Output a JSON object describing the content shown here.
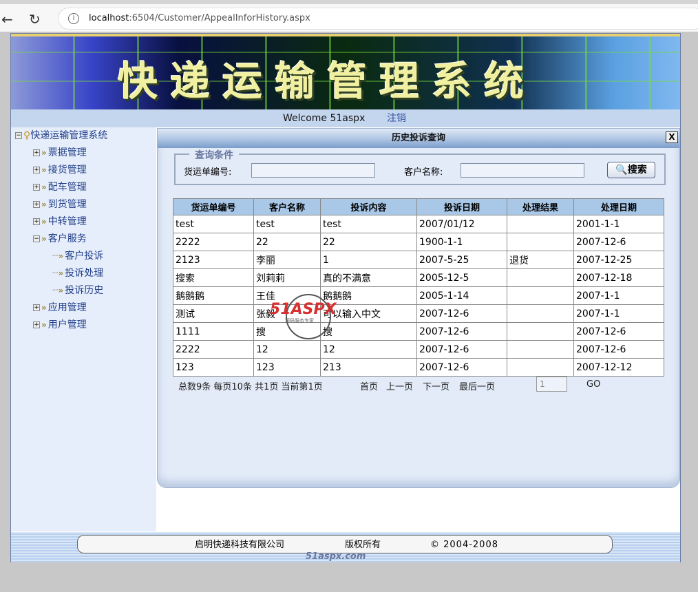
{
  "browser": {
    "url_host": "localhost",
    "url_path": ":6504/Customer/AppealInforHistory.aspx"
  },
  "banner": {
    "title": "快递运输管理系统"
  },
  "welcome": {
    "text": "Welcome 51aspx",
    "logout": "注销"
  },
  "sidebar": {
    "root": "快递运输管理系统",
    "items": [
      {
        "label": "票据管理",
        "expanded": false
      },
      {
        "label": "接货管理",
        "expanded": false
      },
      {
        "label": "配车管理",
        "expanded": false
      },
      {
        "label": "到货管理",
        "expanded": false
      },
      {
        "label": "中转管理",
        "expanded": false
      },
      {
        "label": "客户服务",
        "expanded": true
      },
      {
        "label": "应用管理",
        "expanded": false
      },
      {
        "label": "用户管理",
        "expanded": false
      }
    ],
    "children": [
      "客户投诉",
      "投诉处理",
      "投诉历史"
    ]
  },
  "panel": {
    "title": "历史投诉查询",
    "close": "X"
  },
  "search": {
    "legend": "查询条件",
    "waybill_label": "货运单编号:",
    "waybill_value": "",
    "customer_label": "客户名称:",
    "customer_value": "",
    "button": "搜索"
  },
  "table": {
    "headers": [
      "货运单编号",
      "客户名称",
      "投诉内容",
      "投诉日期",
      "处理结果",
      "处理日期"
    ],
    "rows": [
      [
        "test",
        "test",
        "test",
        "2007/01/12",
        "",
        "2001-1-1"
      ],
      [
        "2222",
        "22",
        "22",
        "1900-1-1",
        "",
        "2007-12-6"
      ],
      [
        "2123",
        "李丽",
        "1",
        "2007-5-25",
        "退货",
        "2007-12-25"
      ],
      [
        "搜索",
        "刘莉莉",
        "真的不满意",
        "2005-12-5",
        "",
        "2007-12-18"
      ],
      [
        "鹅鹅鹅",
        "王佳",
        "鹅鹅鹅",
        "2005-1-14",
        "",
        "2007-1-1"
      ],
      [
        "测试",
        "张毅",
        "可以输入中文",
        "2007-12-6",
        "",
        "2007-1-1"
      ],
      [
        "1111",
        "搜",
        "搜",
        "2007-12-6",
        "",
        "2007-12-6"
      ],
      [
        "2222",
        "12",
        "12",
        "2007-12-6",
        "",
        "2007-12-6"
      ],
      [
        "123",
        "123",
        "213",
        "2007-12-6",
        "",
        "2007-12-12"
      ]
    ]
  },
  "pager": {
    "summary": "总数9条 每页10条 共1页 当前第1页",
    "first": "首页",
    "prev": "上一页",
    "next": "下一页",
    "last": "最后一页",
    "page": "1",
    "go": "GO"
  },
  "watermark": {
    "text": "51ASPX",
    "sub": "源码服务专家"
  },
  "footer": {
    "company": "启明快递科技有限公司",
    "rights": "版权所有",
    "copyright": "© 2004-2008",
    "site": "51aspx.com"
  }
}
